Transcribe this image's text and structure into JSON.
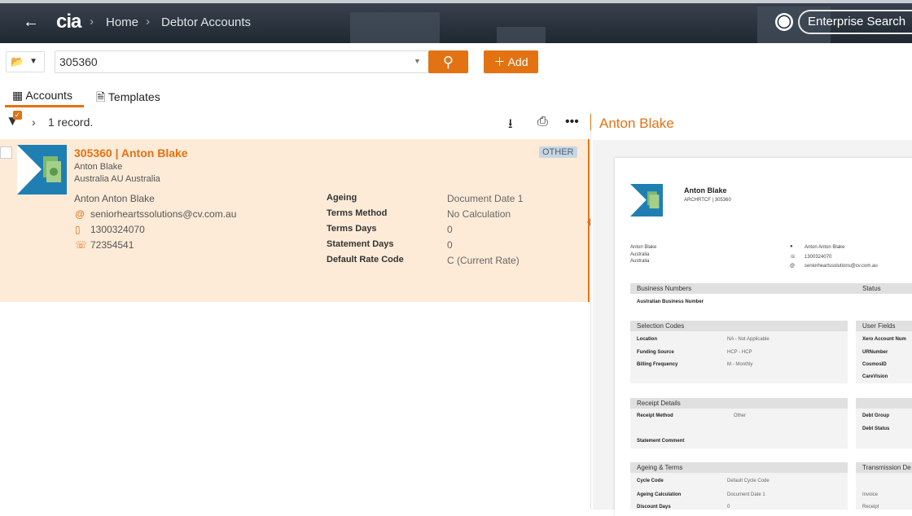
{
  "header": {
    "back_icon": "arrow-left-icon",
    "logo": "cia",
    "breadcrumb": [
      "Home",
      "Debtor Accounts"
    ],
    "enterprise_search": "Enterprise Search"
  },
  "toolbar": {
    "search_value": "305360",
    "add_label": "Add"
  },
  "tabs": [
    {
      "label": "Accounts",
      "active": true
    },
    {
      "label": "Templates",
      "active": false
    }
  ],
  "results": {
    "count_text": "1 record."
  },
  "preview_header": "Anton Blake",
  "account": {
    "title": "305360 | Anton Blake",
    "name": "Anton Blake",
    "location": "Australia AU Australia",
    "tag": "OTHER",
    "contact_name": "Anton Anton Blake",
    "email": "seniorheartssolutions@cv.com.au",
    "mobile": "1300324070",
    "phone": "72354541",
    "fields": [
      {
        "key": "Ageing",
        "value": "Document Date 1"
      },
      {
        "key": "Terms Method",
        "value": "No Calculation"
      },
      {
        "key": "Terms Days",
        "value": "0"
      },
      {
        "key": "Statement Days",
        "value": "0"
      },
      {
        "key": "Default Rate Code",
        "value": "C (Current Rate)"
      }
    ]
  },
  "preview": {
    "title": "Anton Blake",
    "sub": "ARCHRTCF | 305360",
    "addr": [
      "Anton Blake",
      "Australia",
      "Australia"
    ],
    "contact": [
      "Anton Anton Blake",
      "1300324070",
      "seniorheartssolutions@cv.com.au"
    ],
    "sections": {
      "business_numbers": "Business Numbers",
      "status": "Status",
      "abn": "Australian Business Number",
      "selection_codes": "Selection Codes",
      "user_fields": "User Fields",
      "receipt_details": "Receipt Details",
      "ageing_terms": "Ageing & Terms",
      "transmission": "Transmission De"
    },
    "selection": [
      {
        "key": "Location",
        "value": "NA - Not Applicable"
      },
      {
        "key": "Funding Source",
        "value": "HCP - HCP"
      },
      {
        "key": "Billing Frequency",
        "value": "M - Monthly"
      }
    ],
    "user_fields": [
      "Xero Account Num",
      "URNumber",
      "CosmosID",
      "CareVision"
    ],
    "receipt": {
      "key": "Receipt Method",
      "value": "Other"
    },
    "statement_comment": "Statement Comment",
    "debt": [
      "Debt Group",
      "Debt Status"
    ],
    "ageing": [
      {
        "key": "Cycle Code",
        "value": "Default Cycle Code"
      },
      {
        "key": "Ageing Calculation",
        "value": "Document Date 1"
      },
      {
        "key": "Discount Days",
        "value": "0"
      }
    ],
    "transmission": [
      "Invoice",
      "Receipt"
    ]
  }
}
